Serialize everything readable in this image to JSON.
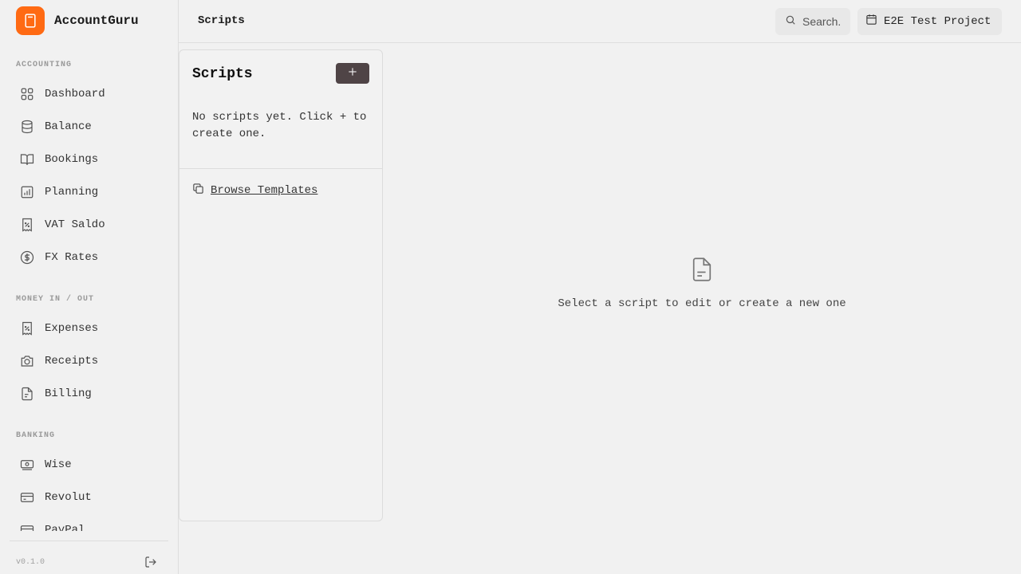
{
  "app": {
    "name": "AccountGuru",
    "accent": "#ff6a13"
  },
  "sidebar": {
    "sections": [
      {
        "label": "ACCOUNTING"
      },
      {
        "label": "MONEY IN / OUT"
      },
      {
        "label": "BANKING"
      }
    ],
    "items": [
      {
        "label": "Dashboard",
        "icon": "grid-icon"
      },
      {
        "label": "Balance",
        "icon": "database-icon"
      },
      {
        "label": "Bookings",
        "icon": "book-icon"
      },
      {
        "label": "Planning",
        "icon": "chart-icon"
      },
      {
        "label": "VAT Saldo",
        "icon": "receipt-percent-icon"
      },
      {
        "label": "FX Rates",
        "icon": "dollar-circle-icon"
      },
      {
        "label": "Expenses",
        "icon": "receipt-percent-icon"
      },
      {
        "label": "Receipts",
        "icon": "camera-icon"
      },
      {
        "label": "Billing",
        "icon": "file-text-icon"
      },
      {
        "label": "Wise",
        "icon": "banknote-icon"
      },
      {
        "label": "Revolut",
        "icon": "credit-card-icon"
      },
      {
        "label": "PayPal",
        "icon": "wallet-icon"
      }
    ],
    "version": "v0.1.0"
  },
  "header": {
    "title": "Scripts",
    "search_label": "Search.",
    "project_label": "E2E Test Project"
  },
  "scripts_panel": {
    "title": "Scripts",
    "empty_message": "No scripts yet. Click + to create one.",
    "browse_templates": "Browse Templates"
  },
  "main": {
    "empty_text": "Select a script to edit or create a new one"
  }
}
